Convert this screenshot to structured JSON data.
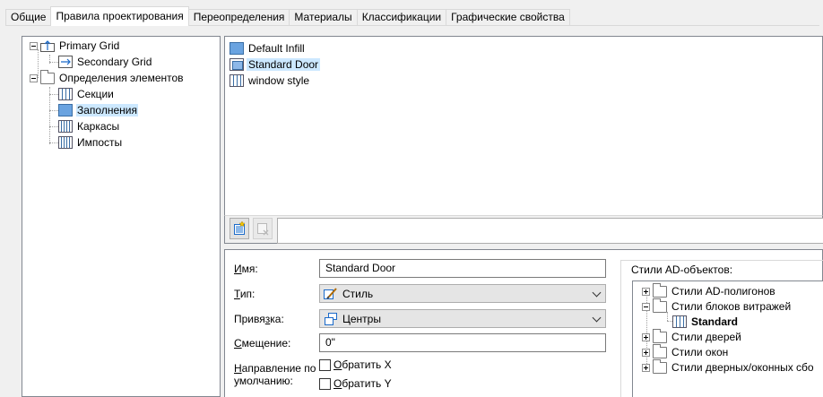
{
  "tabs": [
    {
      "label": "Общие",
      "active": false
    },
    {
      "label": "Правила проектирования",
      "active": true
    },
    {
      "label": "Переопределения",
      "active": false
    },
    {
      "label": "Материалы",
      "active": false
    },
    {
      "label": "Классификации",
      "active": false
    },
    {
      "label": "Графические свойства",
      "active": false
    }
  ],
  "tree": {
    "primary_grid": "Primary Grid",
    "secondary_grid": "Secondary Grid",
    "element_definitions": "Определения элементов",
    "sections": "Секции",
    "infills": "Заполнения",
    "frames": "Каркасы",
    "mullions": "Импосты"
  },
  "list": {
    "items": [
      "Default Infill",
      "Standard Door",
      "window style"
    ],
    "selected_index": 1
  },
  "toolbar": {
    "add_icon": "new-element-icon",
    "delete_icon": "delete-element-icon"
  },
  "props": {
    "name_label_u": "И",
    "name_label_rest": "мя:",
    "name_value": "Standard Door",
    "type_label_u": "Т",
    "type_label_rest": "ип:",
    "type_value": "Стиль",
    "binding_label_pre": "Привя",
    "binding_label_u": "з",
    "binding_label_rest": "ка:",
    "binding_value": "Центры",
    "offset_label_u": "С",
    "offset_label_rest": "мещение:",
    "offset_value": "0\"",
    "direction_label_u": "Н",
    "direction_label_rest": "аправление по",
    "direction_label_line2": "умолчанию:",
    "flip_x_u": "О",
    "flip_x_rest": "братить X",
    "flip_y_u": "О",
    "flip_y_rest": "братить Y"
  },
  "ad_styles": {
    "title": "Стили AD-объектов:",
    "items": {
      "polygons": "Стили AD-полигонов",
      "curtain_blocks": "Стили блоков витражей",
      "standard": "Standard",
      "doors": "Стили дверей",
      "windows": "Стили окон",
      "door_window": "Стили дверных/оконных сбо"
    }
  }
}
